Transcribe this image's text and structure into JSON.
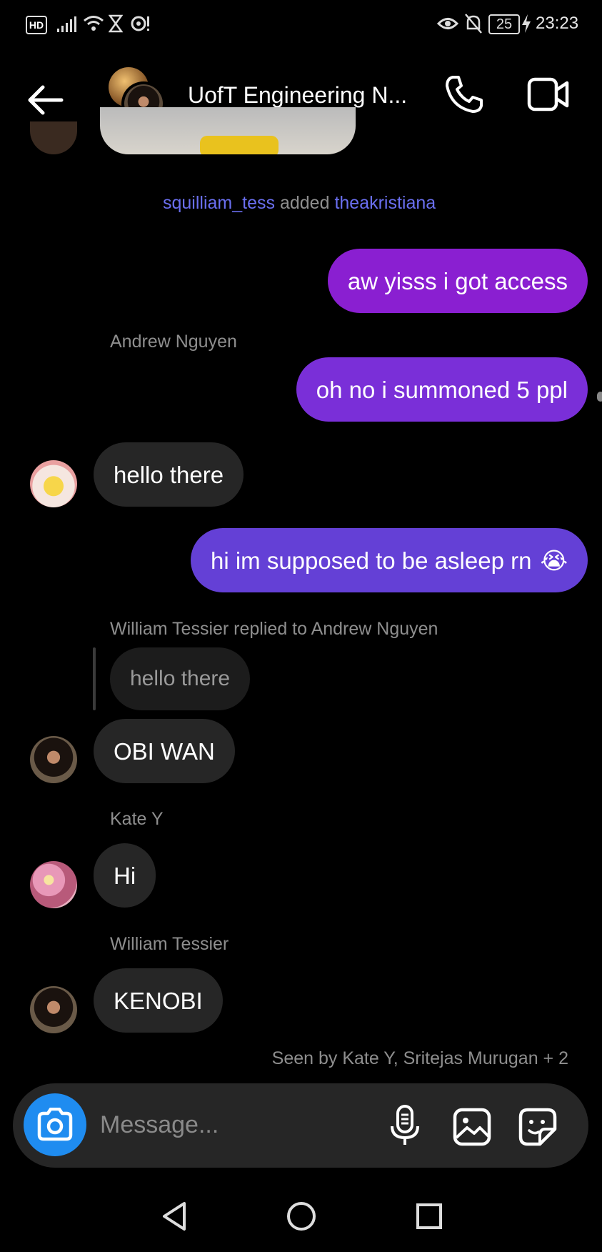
{
  "status_bar": {
    "left_badge": "HD",
    "battery": "25",
    "time": "23:23"
  },
  "header": {
    "title": "UofT Engineering N...",
    "back_icon": "arrow-left-icon",
    "call_icon": "phone-icon",
    "video_icon": "video-camera-icon"
  },
  "system_message": {
    "actor": "squilliam_tess",
    "verb": "added",
    "target": "theakristiana"
  },
  "messages": [
    {
      "type": "outgoing",
      "text": "aw yisss i got access"
    },
    {
      "type": "sender_label",
      "text": "Andrew Nguyen"
    },
    {
      "type": "outgoing",
      "text": "oh no i summoned 5 ppl"
    },
    {
      "type": "incoming",
      "text": "hello there",
      "avatar": "pikachu-avatar"
    },
    {
      "type": "outgoing",
      "text": "hi im supposed to be asleep rn",
      "emoji": "😭"
    },
    {
      "type": "reply_label",
      "text": "William Tessier replied to Andrew Nguyen"
    },
    {
      "type": "quoted",
      "text": "hello there"
    },
    {
      "type": "incoming",
      "text": "OBI WAN",
      "avatar": "william-avatar"
    },
    {
      "type": "sender_label",
      "text": "Kate Y"
    },
    {
      "type": "incoming",
      "text": "Hi",
      "avatar": "flowers-avatar"
    },
    {
      "type": "sender_label",
      "text": "William Tessier"
    },
    {
      "type": "incoming",
      "text": "KENOBI",
      "avatar": "william-avatar"
    }
  ],
  "seen_by": "Seen by Kate Y, Sritejas Murugan + 2",
  "composer": {
    "placeholder": "Message...",
    "camera_icon": "camera-icon",
    "mic_icon": "microphone-icon",
    "gallery_icon": "image-icon",
    "sticker_icon": "sticker-icon"
  },
  "nav": {
    "back": "triangle-back-icon",
    "home": "circle-home-icon",
    "recents": "square-recents-icon"
  },
  "colors": {
    "outgoing_top": "#8a1fd1",
    "outgoing_mid": "#7a2fd8",
    "outgoing_bottom": "#6440d6",
    "incoming": "#262626",
    "link": "#6a6ff0",
    "camera_button": "#1f8cf0"
  }
}
